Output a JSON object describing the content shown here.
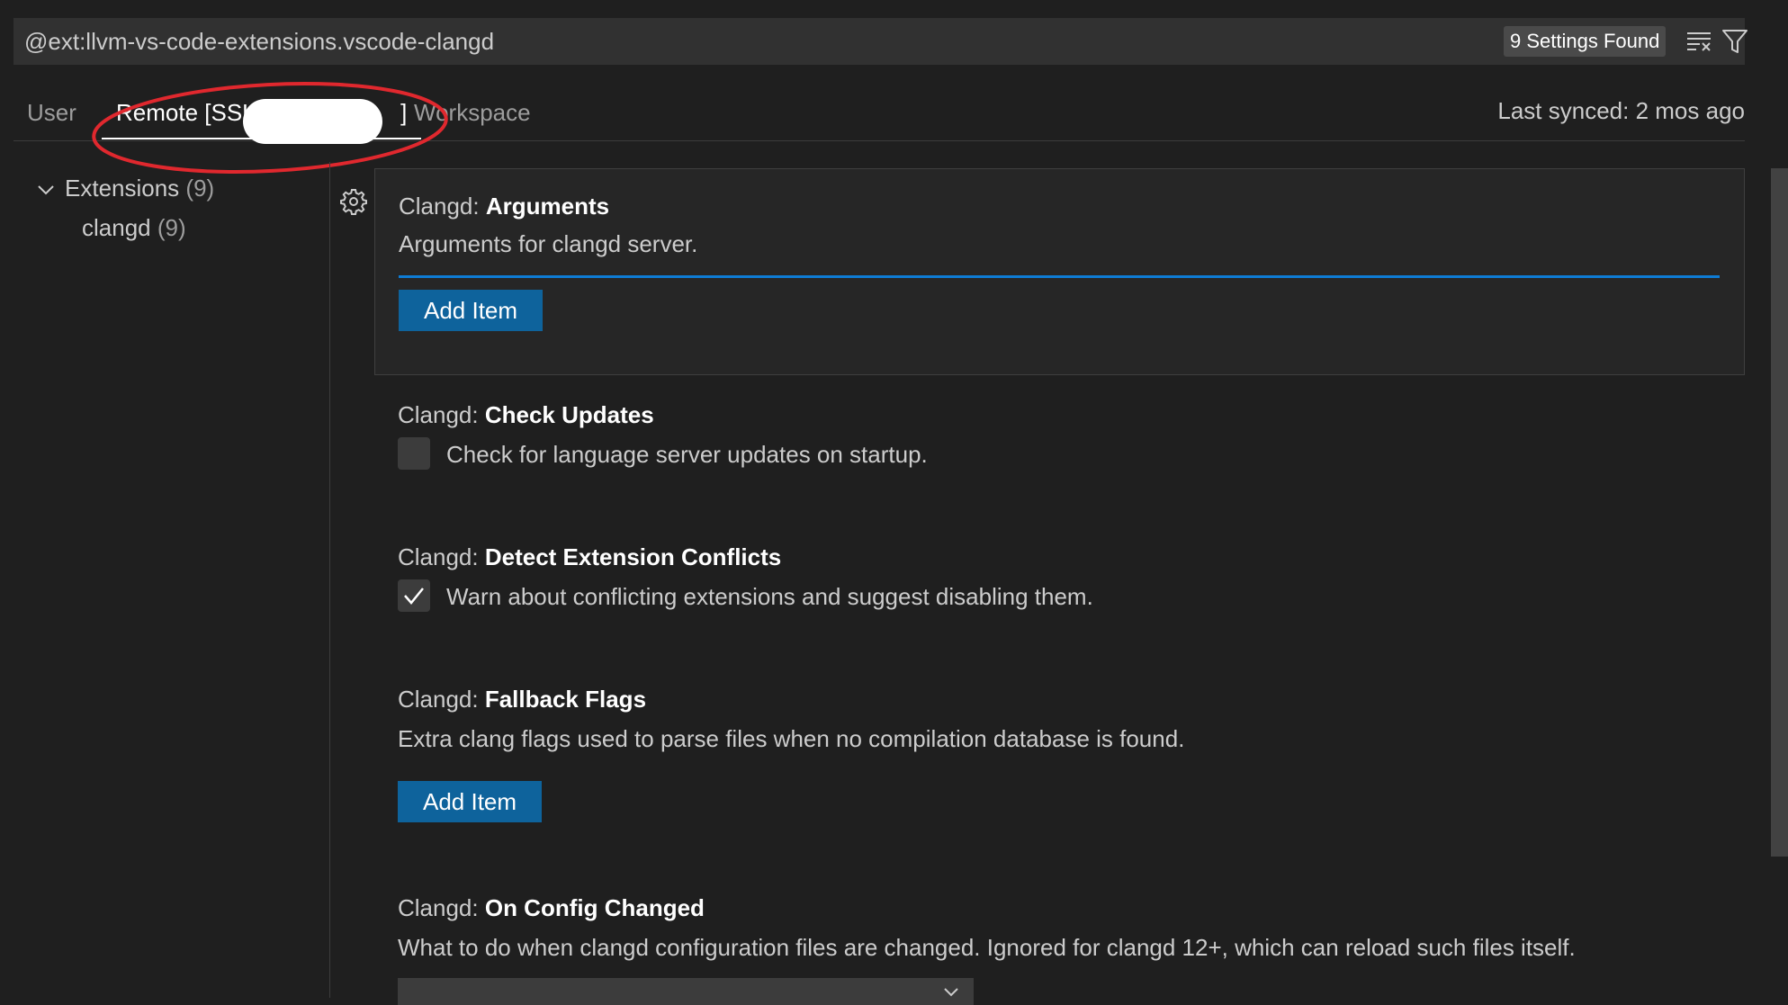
{
  "search": {
    "query": "@ext:llvm-vs-code-extensions.vscode-clangd",
    "results_badge": "9 Settings Found"
  },
  "tabs": {
    "user": "User",
    "remote": "Remote [SSH:",
    "remote_suffix": "]",
    "workspace": "Workspace",
    "last_synced": "Last synced: 2 mos ago"
  },
  "toc": {
    "extensions": {
      "label": "Extensions",
      "count": "(9)"
    },
    "clangd": {
      "label": "clangd",
      "count": "(9)"
    }
  },
  "settings": [
    {
      "category": "Clangd: ",
      "name": "Arguments",
      "description": "Arguments for clangd server.",
      "button": "Add Item"
    },
    {
      "category": "Clangd: ",
      "name": "Check Updates",
      "description": "Check for language server updates on startup.",
      "checked": false
    },
    {
      "category": "Clangd: ",
      "name": "Detect Extension Conflicts",
      "description": "Warn about conflicting extensions and suggest disabling them.",
      "checked": true
    },
    {
      "category": "Clangd: ",
      "name": "Fallback Flags",
      "description": "Extra clang flags used to parse files when no compilation database is found.",
      "button": "Add Item"
    },
    {
      "category": "Clangd: ",
      "name": "On Config Changed",
      "description": "What to do when clangd configuration files are changed. Ignored for clangd 12+, which can reload such files itself."
    }
  ],
  "colors": {
    "background": "#1f1f1f",
    "accent": "#0e639c",
    "focus_line": "#0e7cd4",
    "annotation": "#e0282e"
  }
}
